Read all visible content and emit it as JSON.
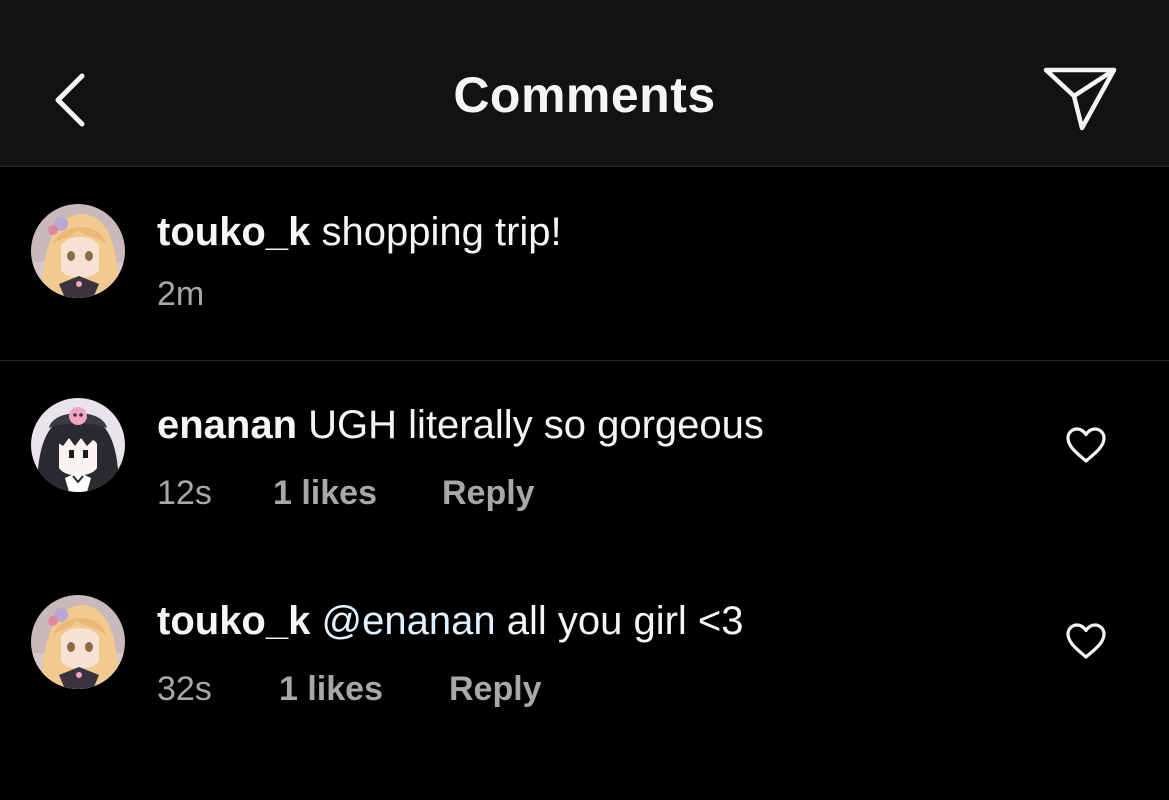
{
  "header": {
    "title": "Comments",
    "back_icon": "chevron-left-icon",
    "share_icon": "paper-plane-icon"
  },
  "caption": {
    "username": "touko_k",
    "text": "shopping trip!",
    "time": "2m",
    "avatar": "blonde-anime-girl-avatar"
  },
  "comments": [
    {
      "username": "enanan",
      "text": "UGH literally so gorgeous",
      "time": "12s",
      "likes": "1 likes",
      "reply": "Reply",
      "avatar": "dark-hair-anime-girl-skull-hat-avatar",
      "like_icon": "heart-outline-icon"
    },
    {
      "username": "touko_k",
      "mention": "@enanan",
      "text": "all you girl <3",
      "time": "32s",
      "likes": "1 likes",
      "reply": "Reply",
      "avatar": "blonde-anime-girl-avatar",
      "like_icon": "heart-outline-icon"
    }
  ],
  "colors": {
    "background": "#000000",
    "header_background": "#121212",
    "divider": "#262626",
    "primary_text": "#f5f5f5",
    "secondary_text": "#a8a8a8",
    "mention": "#e0f1ff"
  }
}
